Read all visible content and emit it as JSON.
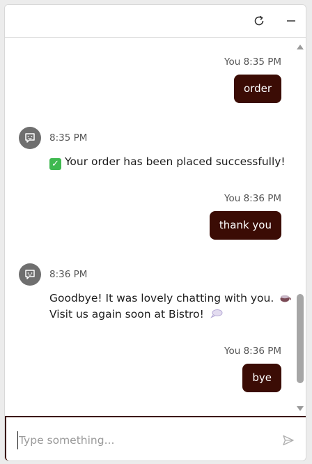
{
  "header": {
    "refresh_icon": "refresh-icon",
    "minimize_icon": "minimize-icon"
  },
  "messages": [
    {
      "sender": "user",
      "time": "You 8:35 PM",
      "text": "order"
    },
    {
      "sender": "bot",
      "time": "8:35 PM",
      "text": "Your order has been placed successfully!",
      "icon": "check-emoji"
    },
    {
      "sender": "user",
      "time": "You 8:36 PM",
      "text": "thank you"
    },
    {
      "sender": "bot",
      "time": "8:36 PM",
      "line1": "Goodbye! It was lovely chatting with you.",
      "line2": "Visit us again soon at Bistro!",
      "icons": [
        "coffee-emoji",
        "speech-bubble-emoji"
      ]
    },
    {
      "sender": "user",
      "time": "You 8:36 PM",
      "text": "bye"
    }
  ],
  "input": {
    "placeholder": "Type something...",
    "value": ""
  },
  "colors": {
    "accent": "#3b0c05",
    "bot_avatar": "#6f6f6f",
    "scrollbar": "#a6a6a6"
  }
}
